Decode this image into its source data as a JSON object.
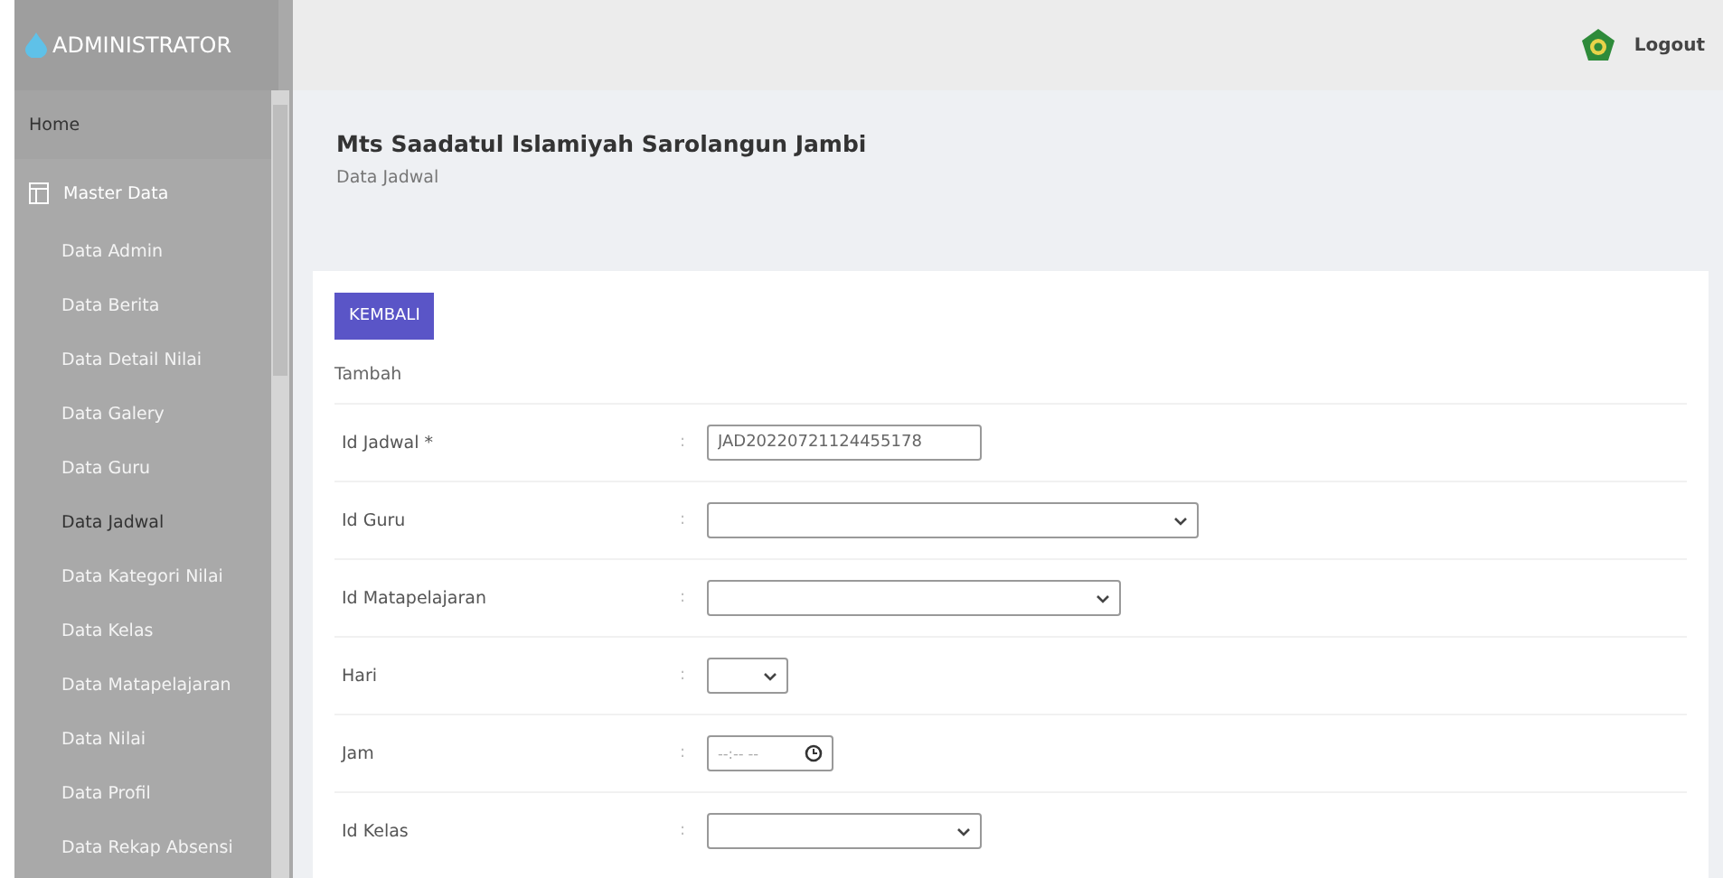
{
  "brand": "ADMINISTRATOR",
  "logout": "Logout",
  "sidebar": {
    "items": [
      {
        "label": "Home",
        "kind": "link"
      },
      {
        "label": "Master Data",
        "kind": "group",
        "children": [
          {
            "label": "Data Admin",
            "selected": false
          },
          {
            "label": "Data Berita",
            "selected": false
          },
          {
            "label": "Data Detail Nilai",
            "selected": false
          },
          {
            "label": "Data Galery",
            "selected": false
          },
          {
            "label": "Data Guru",
            "selected": false
          },
          {
            "label": "Data Jadwal",
            "selected": true
          },
          {
            "label": "Data Kategori Nilai",
            "selected": false
          },
          {
            "label": "Data Kelas",
            "selected": false
          },
          {
            "label": "Data Matapelajaran",
            "selected": false
          },
          {
            "label": "Data Nilai",
            "selected": false
          },
          {
            "label": "Data Profil",
            "selected": false
          },
          {
            "label": "Data Rekap Absensi",
            "selected": false
          }
        ]
      }
    ]
  },
  "page": {
    "title": "Mts Saadatul Islamiyah Sarolangun Jambi",
    "subtitle": "Data Jadwal"
  },
  "card": {
    "back_button": "KEMBALI",
    "section": "Tambah",
    "separator": ":",
    "fields": [
      {
        "label": "Id Jadwal *",
        "kind": "text",
        "value": "JAD20220721124455178"
      },
      {
        "label": "Id Guru",
        "kind": "select"
      },
      {
        "label": "Id Matapelajaran",
        "kind": "select"
      },
      {
        "label": "Hari",
        "kind": "select"
      },
      {
        "label": "Jam",
        "kind": "time",
        "placeholder": "--:-- --"
      },
      {
        "label": "Id Kelas",
        "kind": "select"
      }
    ]
  }
}
